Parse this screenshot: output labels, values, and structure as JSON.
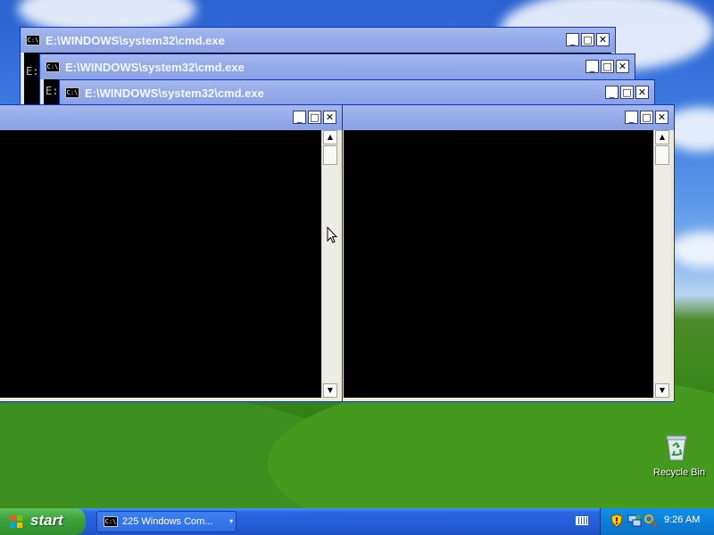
{
  "windows": [
    {
      "title": "E:\\WINDOWS\\system32\\cmd.exe",
      "icon_text": "C:\\",
      "prompt_fragment": "E:"
    },
    {
      "title": "E:\\WINDOWS\\system32\\cmd.exe",
      "icon_text": "C:\\",
      "prompt_fragment": "E:"
    },
    {
      "title": "E:\\WINDOWS\\system32\\cmd.exe",
      "icon_text": "C:\\",
      "prompt_fragment": "E:"
    }
  ],
  "window_controls": {
    "minimize": "_",
    "maximize": "□",
    "close": "✕"
  },
  "scrollbar": {
    "up": "▲",
    "down": "▼"
  },
  "taskbar": {
    "start_label": "start",
    "task_button_label": "225 Windows Com...",
    "task_button_icon_text": "C:\\",
    "task_caret": "▾",
    "clock": "9:26 AM"
  },
  "desktop": {
    "recycle_bin_label": "Recycle Bin"
  },
  "icons": {
    "start_logo": "windows-flag-icon",
    "tray": [
      "shield-icon",
      "network-icon",
      "search-icon"
    ],
    "keyboard": "keyboard-icon",
    "recycle": "recycle-bin-icon",
    "cursor": "arrow-cursor-icon"
  }
}
